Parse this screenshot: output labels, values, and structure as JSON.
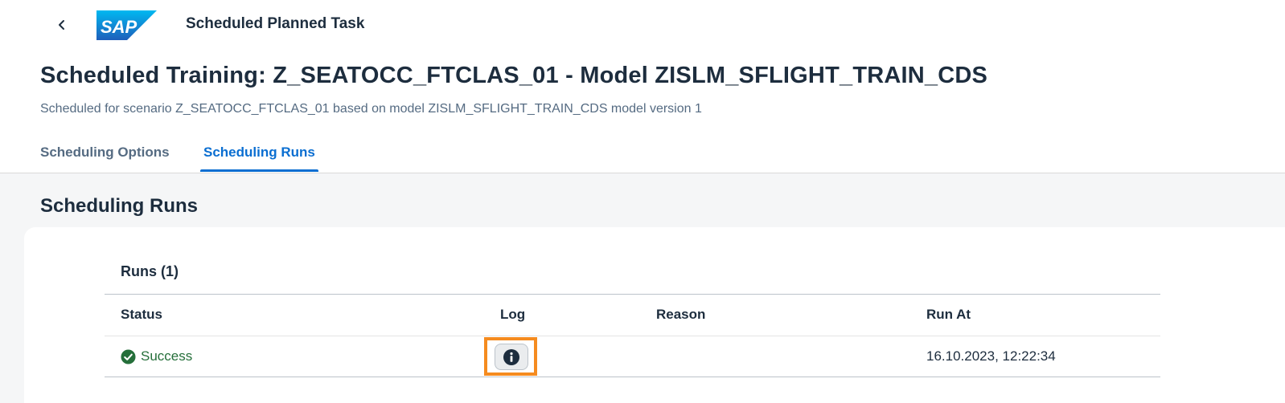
{
  "shellbar": {
    "app_title": "Scheduled Planned Task",
    "logo_text": "SAP"
  },
  "page": {
    "title": "Scheduled Training: Z_SEATOCC_FTCLAS_01 - Model ZISLM_SFLIGHT_TRAIN_CDS",
    "subtitle": "Scheduled for scenario Z_SEATOCC_FTCLAS_01 based on model ZISLM_SFLIGHT_TRAIN_CDS model version 1"
  },
  "tabs": [
    {
      "label": "Scheduling Options",
      "selected": false
    },
    {
      "label": "Scheduling Runs",
      "selected": true
    }
  ],
  "section": {
    "title": "Scheduling Runs"
  },
  "table": {
    "title": "Runs (1)",
    "columns": [
      "Status",
      "Log",
      "Reason",
      "Run At"
    ],
    "rows": [
      {
        "status": "Success",
        "log_icon": "info-icon",
        "reason": "",
        "run_at": "16.10.2023, 12:22:34"
      }
    ]
  },
  "colors": {
    "accent": "#0a6ed1",
    "success": "#256f3a",
    "highlight": "#f58b1f",
    "sap_blue": "#0a6ed1"
  }
}
